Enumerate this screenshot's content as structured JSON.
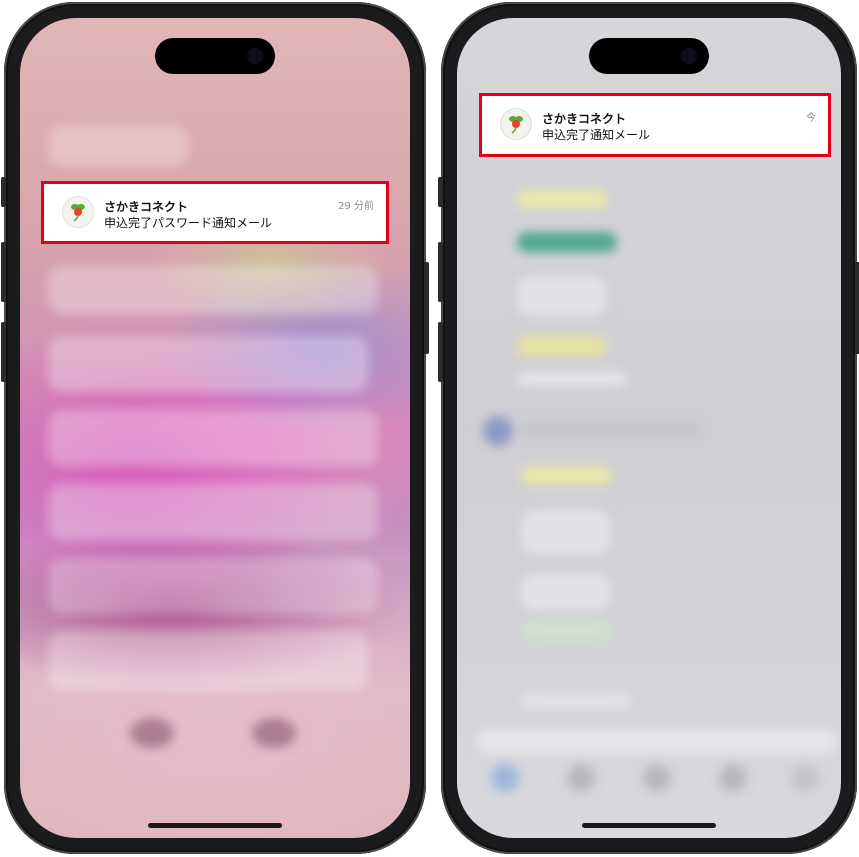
{
  "left_phone": {
    "notification": {
      "app_name": "さかきコネクト",
      "message": "申込完了パスワード通知メール",
      "time": "29 分前",
      "icon": "radish-mascot-icon"
    }
  },
  "right_phone": {
    "notification": {
      "app_name": "さかきコネクト",
      "message": "申込完了通知メール",
      "time": "今",
      "icon": "radish-mascot-icon"
    }
  },
  "colors": {
    "highlight_border": "#e3001b",
    "phone_frame": "#1b1b1d"
  }
}
